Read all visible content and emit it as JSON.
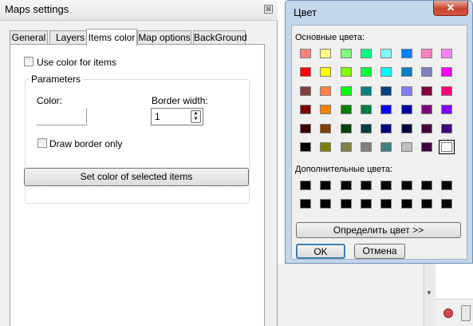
{
  "maps_settings": {
    "title": "Maps settings",
    "close_glyph": "⊠",
    "tabs": [
      "General",
      "Layers",
      "Items color",
      "Map options",
      "BackGround"
    ],
    "active_tab": "Items color",
    "use_color_label": "Use color for items",
    "parameters_label": "Parameters",
    "color_label": "Color:",
    "border_width_label": "Border width:",
    "border_width_value": "1",
    "draw_border_label": "Draw border only",
    "set_color_button": "Set color of selected items"
  },
  "color_dialog": {
    "title": "Цвет",
    "close_glyph": "✕",
    "basic_colors_label": "Основные цвета:",
    "custom_colors_label": "Дополнительные цвета:",
    "define_button": "Определить цвет >>",
    "ok_button": "OK",
    "cancel_button": "Отмена",
    "basic_colors": [
      [
        "#ff8080",
        "#ffff80",
        "#80ff80",
        "#00ff80",
        "#80ffff",
        "#0080ff",
        "#ff80c0",
        "#ff80ff"
      ],
      [
        "#ff0000",
        "#ffff00",
        "#80ff00",
        "#00ff40",
        "#00ffff",
        "#0080c0",
        "#8080c0",
        "#ff00ff"
      ],
      [
        "#804040",
        "#ff8040",
        "#00ff00",
        "#008080",
        "#004080",
        "#8080ff",
        "#800040",
        "#ff0080"
      ],
      [
        "#800000",
        "#ff8000",
        "#008000",
        "#008040",
        "#0000ff",
        "#0000a0",
        "#800080",
        "#8000ff"
      ],
      [
        "#400000",
        "#804000",
        "#004000",
        "#004040",
        "#000080",
        "#000040",
        "#400040",
        "#400080"
      ],
      [
        "#000000",
        "#808000",
        "#808040",
        "#808080",
        "#408080",
        "#c0c0c0",
        "#400040",
        "#ffffff"
      ]
    ],
    "custom_colors": [
      [
        "#000000",
        "#000000",
        "#000000",
        "#000000",
        "#000000",
        "#000000",
        "#000000",
        "#000000"
      ],
      [
        "#000000",
        "#000000",
        "#000000",
        "#000000",
        "#000000",
        "#000000",
        "#000000",
        "#000000"
      ]
    ]
  }
}
